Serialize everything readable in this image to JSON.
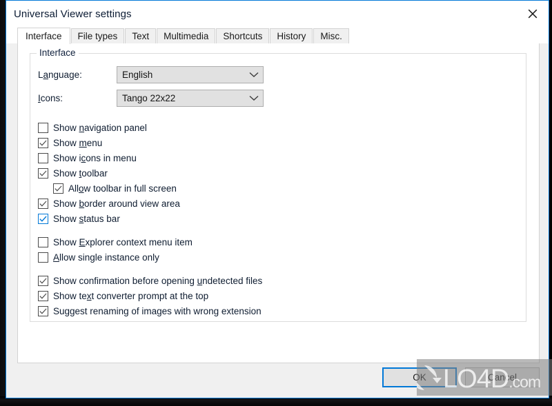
{
  "window": {
    "title": "Universal Viewer settings",
    "close_icon": "close-icon",
    "accent_color": "#0078d7",
    "titlebar_bg": "#ffffff",
    "dialog_bg": "#f0f0f0"
  },
  "tabs": [
    {
      "label": "Interface",
      "selected": true
    },
    {
      "label": "File types",
      "selected": false
    },
    {
      "label": "Text",
      "selected": false
    },
    {
      "label": "Multimedia",
      "selected": false
    },
    {
      "label": "Shortcuts",
      "selected": false
    },
    {
      "label": "History",
      "selected": false
    },
    {
      "label": "Misc.",
      "selected": false
    }
  ],
  "interface_group": {
    "legend": "Interface",
    "fields": [
      {
        "label_before": "L",
        "label_accel": "a",
        "label_after": "nguage:",
        "value": "English",
        "chevron": "chevron-down-icon"
      },
      {
        "label_before": "",
        "label_accel": "I",
        "label_after": "cons:",
        "value": "Tango 22x22",
        "chevron": "chevron-down-icon"
      }
    ],
    "checkboxes": [
      {
        "name": "show-navigation-panel",
        "before": "Show ",
        "accel": "n",
        "after": "avigation panel",
        "checked": false,
        "focused": false,
        "indent": 0
      },
      {
        "name": "show-menu",
        "before": "Show ",
        "accel": "m",
        "after": "enu",
        "checked": true,
        "focused": false,
        "indent": 0
      },
      {
        "name": "show-icons-in-menu",
        "before": "Show i",
        "accel": "c",
        "after": "ons in menu",
        "checked": false,
        "focused": false,
        "indent": 0
      },
      {
        "name": "show-toolbar",
        "before": "Show ",
        "accel": "t",
        "after": "oolbar",
        "checked": true,
        "focused": false,
        "indent": 0
      },
      {
        "name": "allow-toolbar-in-full-screen",
        "before": "All",
        "accel": "o",
        "after": "w toolbar in full screen",
        "checked": true,
        "focused": false,
        "indent": 1
      },
      {
        "name": "show-border-around-view-area",
        "before": "Show ",
        "accel": "b",
        "after": "order around view area",
        "checked": true,
        "focused": false,
        "indent": 0
      },
      {
        "name": "show-status-bar",
        "before": "Show ",
        "accel": "s",
        "after": "tatus bar",
        "checked": true,
        "focused": true,
        "indent": 0
      },
      {
        "name": "show-explorer-context-menu-item",
        "before": "Show ",
        "accel": "E",
        "after": "xplorer context menu item",
        "checked": false,
        "focused": false,
        "indent": 0
      },
      {
        "name": "allow-single-instance-only",
        "before": "",
        "accel": "A",
        "after": "llow single instance only",
        "checked": false,
        "focused": false,
        "indent": 0
      },
      {
        "name": "show-confirmation-before-opening-undetected-files",
        "before": "Show confirmation before opening ",
        "accel": "u",
        "after": "ndetected files",
        "checked": true,
        "focused": false,
        "indent": 0
      },
      {
        "name": "show-text-converter-prompt-at-the-top",
        "before": "Show te",
        "accel": "x",
        "after": "t converter prompt at the top",
        "checked": true,
        "focused": false,
        "indent": 0
      },
      {
        "name": "suggest-renaming-of-images-with-wrong-extension",
        "before": "Su",
        "accel": "g",
        "after": "gest renaming of images with wrong extension",
        "checked": true,
        "focused": false,
        "indent": 0
      }
    ]
  },
  "footer": {
    "ok_label": "OK",
    "cancel_label": "Cancel"
  },
  "watermark": {
    "text": "LO4D",
    "suffix": ".com",
    "logo_icon": "refresh-circle-icon"
  }
}
